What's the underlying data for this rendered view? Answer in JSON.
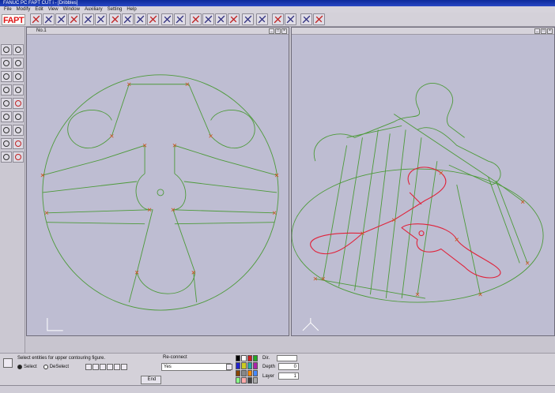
{
  "app": {
    "title": "FANUC PC FAPT CUT i - [Dribbles]"
  },
  "menu": [
    "File",
    "Modify",
    "Edit",
    "View",
    "Window",
    "Auxiliary",
    "Setting",
    "Help"
  ],
  "toolbar": {
    "logo": "FAPT"
  },
  "views": [
    {
      "title": "No.1"
    },
    {
      "title": ""
    }
  ],
  "bottom": {
    "message": "Select entities for upper contouring figure.",
    "reconnect_label": "Re-connect",
    "reconnect_value": "Yes",
    "select_label": "Select",
    "deselect_label": "DeSelect",
    "end_label": "End",
    "dir_label": "Dir.",
    "depth_label": "Depth",
    "depth_value": "0",
    "layer_label": "Layer",
    "layer_value": "1"
  },
  "colors": {
    "background": "#bebdd2",
    "wire": "#4d9a3a",
    "highlight": "#e0223a",
    "point": "#cc5522"
  },
  "palette": [
    "#000000",
    "#ffffff",
    "#cc2222",
    "#22aa22",
    "#2222cc",
    "#cccc22",
    "#22aaaa",
    "#aa22aa",
    "#884400",
    "#888888",
    "#ff8800",
    "#4488ff",
    "#88ff88",
    "#ffaaaa",
    "#444444",
    "#aaaaaa"
  ]
}
